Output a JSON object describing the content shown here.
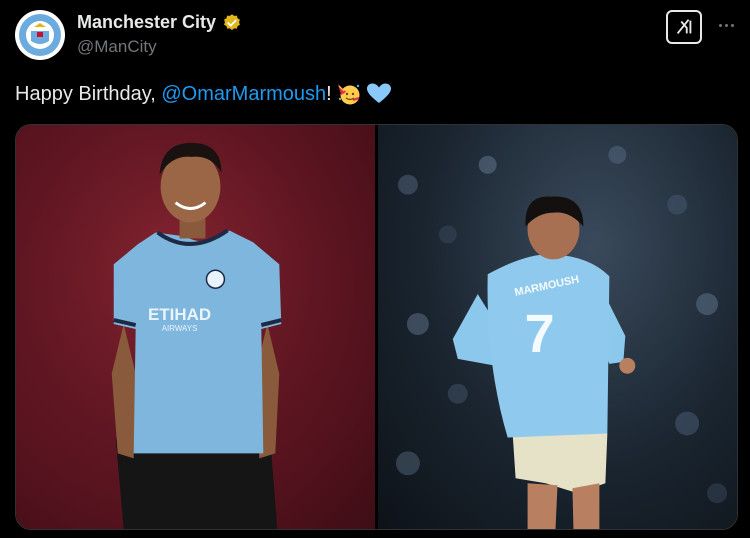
{
  "account": {
    "display_name": "Manchester City",
    "handle": "@ManCity",
    "verified_icon": "verified-gold-badge-icon",
    "avatar_icon": "club-crest-icon",
    "crest_text": "MANCHESTER CITY"
  },
  "actions": {
    "grok_icon": "grok-icon",
    "more_icon": "more-dots-icon"
  },
  "tweet": {
    "text_prefix": "Happy Birthday, ",
    "mention": "@OmarMarmoush",
    "text_suffix": "!",
    "emojis": [
      "party-face-emoji",
      "light-blue-heart-emoji"
    ]
  },
  "media": {
    "left_photo": {
      "shirt_sponsor": "ETIHAD",
      "shirt_sponsor_sub": "AIRWAYS"
    },
    "right_photo": {
      "shirt_name": "MARMOUSH",
      "shirt_number": "7"
    }
  },
  "colors": {
    "link": "#1d9bf0",
    "background": "#000000",
    "verified_gold": "#e2b719",
    "city_blue": "#6cabdd"
  }
}
